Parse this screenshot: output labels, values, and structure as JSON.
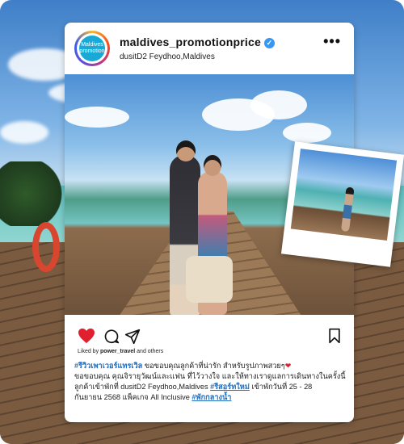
{
  "post": {
    "username": "maldives_promotionprice",
    "location": "dusitD2 Feydhoo,Maldives",
    "avatar_text": [
      "Maldives",
      "promotion"
    ],
    "liked_by_prefix": "Liked by ",
    "liked_by_user": "power_travel",
    "liked_by_suffix": " and others",
    "caption": {
      "hashtag1": "#รีวิวเพาเวอร์แทรเวิล",
      "line1": " ขอขอบคุณลูกค้าที่น่ารัก สำหรับรูปภาพสวยๆ",
      "line2": "ขอขอบคุณ คุณจิรายุวัฒน์และแฟน ที่ไว้วางใจ และให้ทางเราดูแลการเดินทางในครั้งนี้",
      "line3": "ลูกค้าเข้าพักที่ dusitD2 Feydhoo,Maldives ",
      "hashtag2": "#รีสอร์ทใหม่",
      "line3b": " เข้าพักวันที่ 25 - 28",
      "line4": "กันยายน 2568 แพ็คเกจ All Inclusive ",
      "hashtag3": "#พักกลางน้ำ"
    }
  },
  "icons": {
    "more": "more-dots-icon",
    "verified": "verified-badge-icon",
    "heart": "heart-icon",
    "comment": "comment-icon",
    "share": "share-icon",
    "bookmark": "bookmark-icon"
  },
  "colors": {
    "heart": "#e0202f",
    "verified": "#3897f0",
    "hashtag": "#1f6fc4"
  }
}
